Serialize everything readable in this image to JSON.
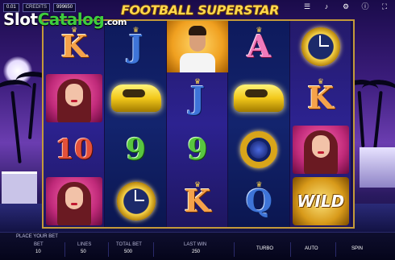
{
  "topbar": {
    "bet_value": "0.01",
    "credits_label": "CREDITS",
    "credits_value": "999650",
    "icons": [
      "menu-icon",
      "sound-icon",
      "settings-icon",
      "info-icon",
      "fullscreen-icon"
    ]
  },
  "watermark": {
    "slot": "Slot",
    "catalog": "Catalog",
    "com": ".com"
  },
  "game_title": "FOOTBALL SUPERSTAR",
  "reels": [
    [
      "K",
      "woman",
      "10",
      "woman"
    ],
    [
      "J",
      "car",
      "9",
      "watch"
    ],
    [
      "player",
      "J",
      "9",
      "K"
    ],
    [
      "A",
      "car",
      "ring",
      "Q"
    ],
    [
      "watch",
      "K",
      "woman",
      "WILD"
    ]
  ],
  "bottom": {
    "place_your_bet": "PLACE YOUR BET",
    "bet_label": "BET",
    "bet_value": "10",
    "lines_label": "LINES",
    "lines_value": "50",
    "total_bet_label": "TOTAL BET",
    "total_bet_value": "500",
    "last_win_label": "LAST WIN",
    "last_win_value": "250",
    "turbo_label": "TURBO",
    "auto_label": "AUTO",
    "spin_label": "SPIN"
  },
  "colors": {
    "frame": "#c49a3a",
    "title": "#ffd84a",
    "watermark_green": "#3ecd3e"
  }
}
